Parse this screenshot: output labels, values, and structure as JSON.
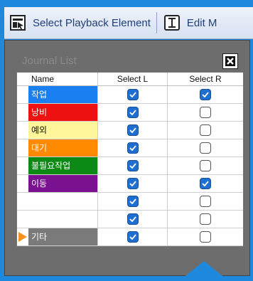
{
  "toolbar": {
    "select_playback_label": "Select Playback Element",
    "edit_label": "Edit M"
  },
  "panel": {
    "title": "Journal List"
  },
  "grid": {
    "headers": {
      "name": "Name",
      "select_l": "Select L",
      "select_r": "Select R"
    },
    "rows": [
      {
        "name": "작업",
        "color": "#1a7ff0",
        "text_color": "#ffffff",
        "select_l": true,
        "select_r": true,
        "current": false
      },
      {
        "name": "낭비",
        "color": "#ee1111",
        "text_color": "#ffffff",
        "select_l": true,
        "select_r": false,
        "current": false
      },
      {
        "name": "예외",
        "color": "#fff59a",
        "text_color": "#111111",
        "select_l": true,
        "select_r": false,
        "current": false
      },
      {
        "name": "대기",
        "color": "#ff8a00",
        "text_color": "#ffffff",
        "select_l": true,
        "select_r": false,
        "current": false
      },
      {
        "name": "불필요작업",
        "color": "#0d8a16",
        "text_color": "#ffffff",
        "select_l": true,
        "select_r": false,
        "current": false
      },
      {
        "name": "이동",
        "color": "#7a1190",
        "text_color": "#ffffff",
        "select_l": true,
        "select_r": true,
        "current": false
      },
      {
        "name": "",
        "color": "#ffffff",
        "text_color": "#111111",
        "select_l": true,
        "select_r": false,
        "current": false
      },
      {
        "name": "",
        "color": "#ffffff",
        "text_color": "#111111",
        "select_l": true,
        "select_r": false,
        "current": false
      },
      {
        "name": "기타",
        "color": "#7a7a7a",
        "text_color": "#ffffff",
        "select_l": true,
        "select_r": false,
        "current": true
      }
    ]
  },
  "colors": {
    "frame_blue": "#1e88dc",
    "indicator_orange": "#f39221",
    "checkbox_blue": "#1f6fd1"
  }
}
